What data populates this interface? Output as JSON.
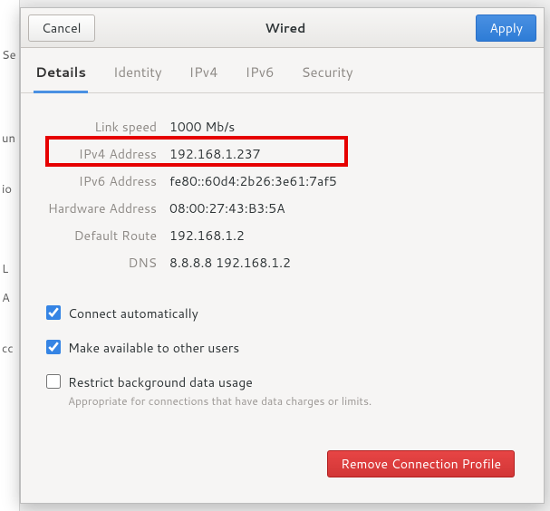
{
  "backdrop_labels": [
    "Se",
    "",
    "un",
    "",
    "io",
    "",
    " L",
    "A",
    "",
    "cc"
  ],
  "header": {
    "cancel": "Cancel",
    "title": "Wired",
    "apply": "Apply"
  },
  "tabs": [
    {
      "label": "Details",
      "active": true
    },
    {
      "label": "Identity",
      "active": false
    },
    {
      "label": "IPv4",
      "active": false
    },
    {
      "label": "IPv6",
      "active": false
    },
    {
      "label": "Security",
      "active": false
    }
  ],
  "details": [
    {
      "label": "Link speed",
      "value": "1000 Mb/s"
    },
    {
      "label": "IPv4 Address",
      "value": "192.168.1.237"
    },
    {
      "label": "IPv6 Address",
      "value": "fe80::60d4:2b26:3e61:7af5"
    },
    {
      "label": "Hardware Address",
      "value": "08:00:27:43:B3:5A"
    },
    {
      "label": "Default Route",
      "value": "192.168.1.2"
    },
    {
      "label": "DNS",
      "value": "8.8.8.8 192.168.1.2"
    }
  ],
  "options": {
    "connect_auto": {
      "label": "Connect automatically",
      "checked": true
    },
    "available_all": {
      "label": "Make available to other users",
      "checked": true
    },
    "restrict_bg": {
      "label": "Restrict background data usage",
      "sub": "Appropriate for connections that have data charges or limits.",
      "checked": false
    }
  },
  "footer": {
    "remove": "Remove Connection Profile"
  }
}
